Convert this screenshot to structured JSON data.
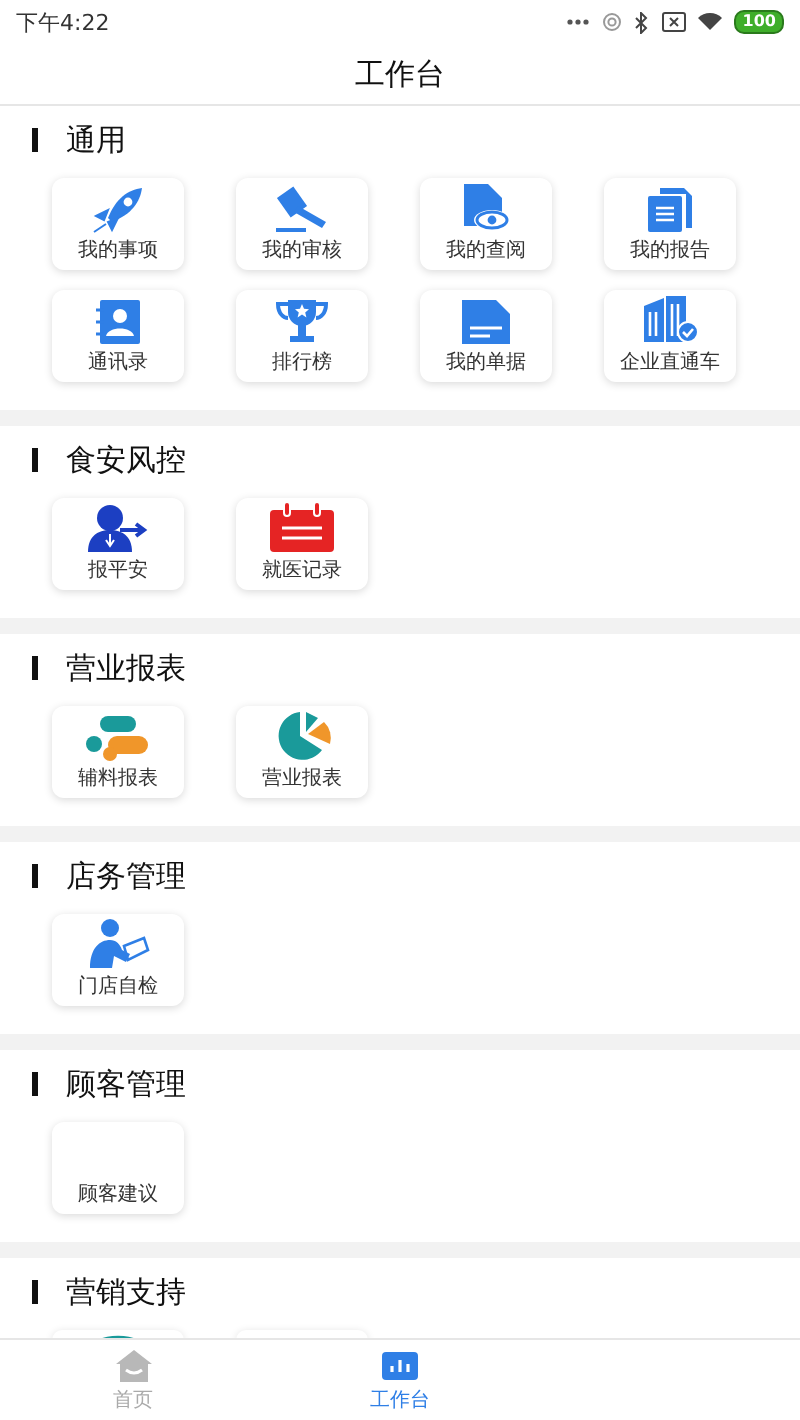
{
  "status_bar": {
    "time": "下午4:22",
    "battery": "100"
  },
  "header": {
    "title": "工作台"
  },
  "sections": [
    {
      "title": "通用",
      "items": [
        {
          "kind": "tile",
          "label": "我的事项"
        },
        {
          "kind": "tile",
          "label": "我的审核"
        },
        {
          "kind": "tile",
          "label": "我的查阅"
        },
        {
          "kind": "tile",
          "label": "我的报告"
        },
        {
          "kind": "tile",
          "label": "通讯录"
        },
        {
          "kind": "tile",
          "label": "排行榜"
        },
        {
          "kind": "tile",
          "label": "我的单据"
        },
        {
          "kind": "tile",
          "label": "企业直通车"
        }
      ]
    },
    {
      "title": "食安风控",
      "items": [
        {
          "kind": "tile",
          "label": "报平安"
        },
        {
          "kind": "tile",
          "label": "就医记录"
        }
      ]
    },
    {
      "title": "营业报表",
      "items": [
        {
          "kind": "tile",
          "label": "辅料报表"
        },
        {
          "kind": "tile",
          "label": "营业报表"
        }
      ]
    },
    {
      "title": "店务管理",
      "items": [
        {
          "kind": "tile",
          "label": "门店自检"
        }
      ]
    },
    {
      "title": "顾客管理",
      "items": [
        {
          "kind": "tile",
          "label": "顾客建议"
        }
      ]
    },
    {
      "title": "营销支持",
      "items": [
        {
          "kind": "partial"
        },
        {
          "kind": "partial"
        }
      ]
    }
  ],
  "tab_bar": [
    {
      "label": "首页",
      "selected": false
    },
    {
      "label": "工作台",
      "selected": true
    }
  ]
}
